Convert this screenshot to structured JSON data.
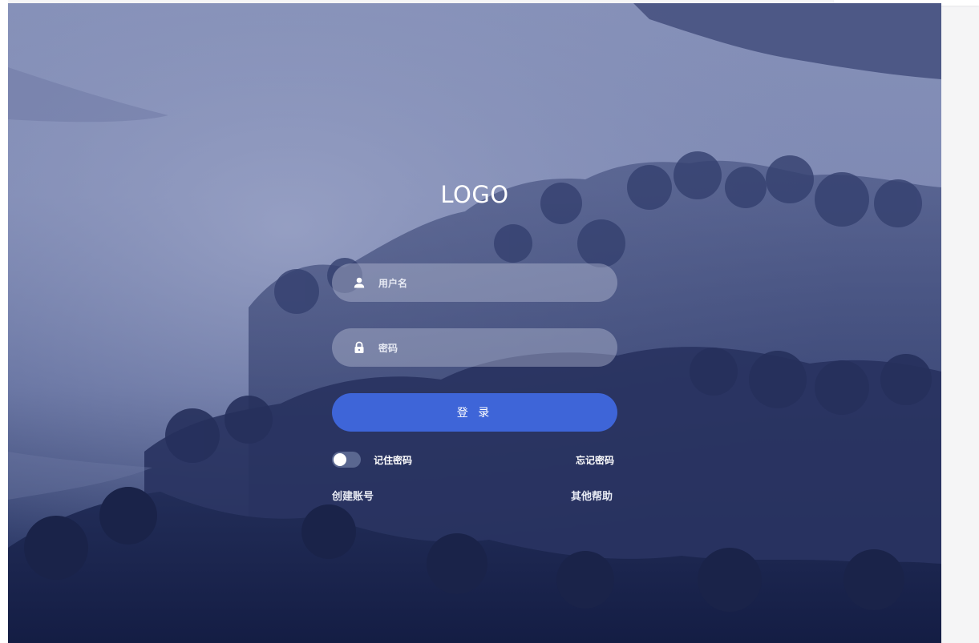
{
  "app": {
    "logo_text": "LOGO"
  },
  "login_form": {
    "username": {
      "placeholder": "用户名",
      "value": "",
      "icon": "user-icon"
    },
    "password": {
      "placeholder": "密码",
      "value": "",
      "icon": "lock-icon"
    },
    "submit_label": "登 录",
    "remember": {
      "label": "记住密码",
      "checked": false
    },
    "forgot_label": "忘记密码",
    "create_account_label": "创建账号",
    "help_label": "其他帮助"
  },
  "colors": {
    "accent": "#3e65d8",
    "background_top": "#8590b8",
    "background_bottom": "#1b2550",
    "text": "#ffffff"
  }
}
